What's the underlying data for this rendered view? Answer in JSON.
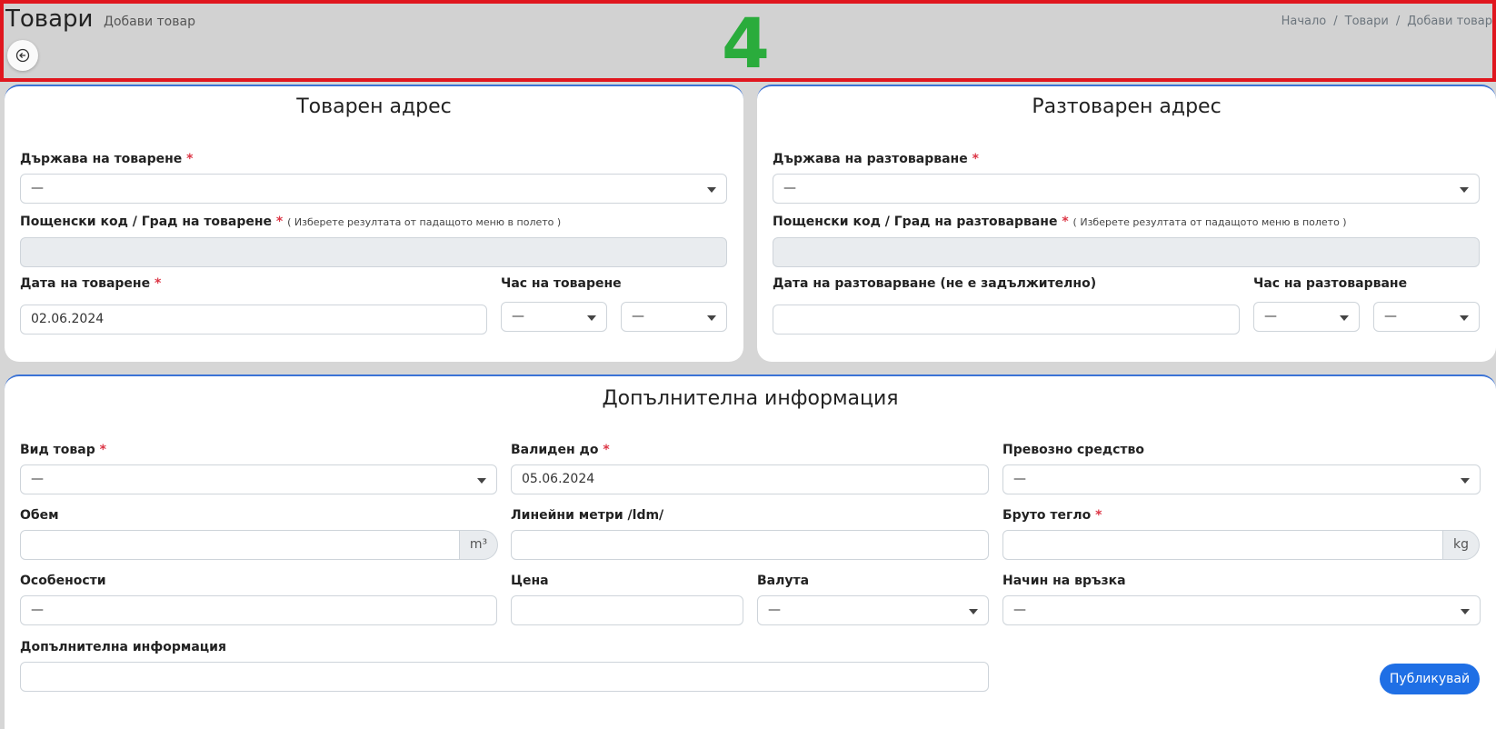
{
  "header": {
    "title": "Товари",
    "subtitle": "Добави товар",
    "big_number": "4",
    "breadcrumb": [
      "Начало",
      "Товари",
      "Добави товар"
    ]
  },
  "loading": {
    "title": "Товарен адрес",
    "country_label": "Държава на товарене",
    "country_value": "—",
    "postal_label": "Пощенски код / Град на товарене",
    "postal_hint": "( Изберете резултата от падащото меню в полето )",
    "date_label": "Дата на товарене",
    "date_value": "02.06.2024",
    "time_label": "Час на товарене",
    "hour_value": "—",
    "minute_value": "—"
  },
  "unloading": {
    "title": "Разтоварен адрес",
    "country_label": "Държава на разтоварване",
    "country_value": "—",
    "postal_label": "Пощенски код / Град на разтоварване",
    "postal_hint": "( Изберете резултата от падащото меню в полето )",
    "date_label": "Дата на разтоварване (не е задължително)",
    "date_value": "",
    "time_label": "Час на разтоварване",
    "hour_value": "—",
    "minute_value": "—"
  },
  "extra": {
    "title": "Допълнителна информация",
    "cargo_type_label": "Вид товар",
    "cargo_type_value": "—",
    "valid_until_label": "Валиден до",
    "valid_until_value": "05.06.2024",
    "vehicle_label": "Превозно средство",
    "vehicle_value": "—",
    "volume_label": "Обем",
    "volume_unit": "m³",
    "ldm_label": "Линейни метри /ldm/",
    "gross_weight_label": "Бруто тегло",
    "gross_weight_unit": "kg",
    "features_label": "Особености",
    "features_value": "—",
    "price_label": "Цена",
    "currency_label": "Валута",
    "currency_value": "—",
    "contact_label": "Начин на връзка",
    "contact_value": "—",
    "additional_label": "Допълнителна информация",
    "required_mark": "*",
    "publish_button": "Публикувай"
  }
}
